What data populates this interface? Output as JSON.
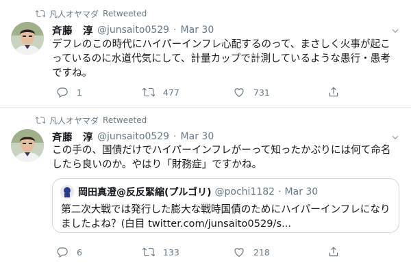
{
  "tweets": [
    {
      "retweeted_by": "凡人オヤマダ",
      "retweet_label": "Retweeted",
      "name": "斉藤　淳",
      "handle": "@junsaito0529",
      "separator": "·",
      "date": "Mar 30",
      "text": "デフレのこの時代にハイパーインフレ心配するのって、まさしく火事が起こっているのに水道代気にして、計量カップで計測しているような愚行・愚考ですね。",
      "actions": {
        "reply": "1",
        "retweet": "477",
        "like": "731"
      }
    },
    {
      "retweeted_by": "凡人オヤマダ",
      "retweet_label": "Retweeted",
      "name": "斉藤　淳",
      "handle": "@junsaito0529",
      "separator": "·",
      "date": "Mar 30",
      "text": "この手の、国債だけでハイパーインフレがーって知ったかぶりには何て命名したら良いのか。やはり「財務症」ですかね。",
      "quote": {
        "name": "岡田真澄@反反緊縮(プルゴリ)",
        "handle": "@pochi1182",
        "separator": "·",
        "date": "Mar 30",
        "text": "第二次大戦では発行した膨大な戦時国債のためにハイパーインフレになりましたよね？(白目 twitter.com/junsaito0529/s..."
      },
      "actions": {
        "reply": "6",
        "retweet": "133",
        "like": "218"
      }
    }
  ],
  "icons": {
    "retweet": "retweet-icon",
    "reply": "reply-icon",
    "like": "heart-icon",
    "share": "share-icon",
    "more": "chevron-down-icon"
  },
  "colors": {
    "secondary_text": "#657786",
    "border": "#e6ecf0",
    "quote_border": "#ccd6dd"
  }
}
